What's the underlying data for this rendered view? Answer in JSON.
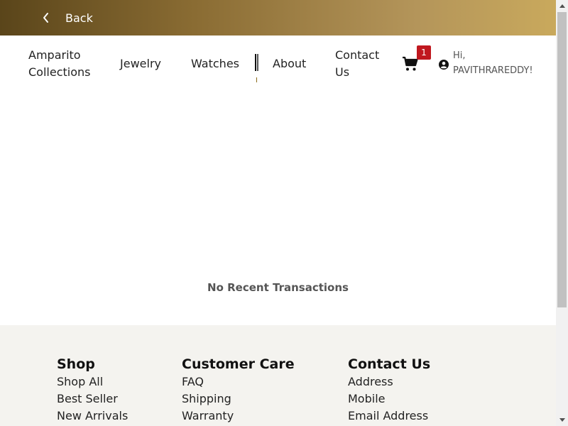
{
  "topbar": {
    "back_label": "Back"
  },
  "nav": {
    "brand": "Amparito Collections",
    "items": [
      {
        "label": "Jewelry"
      },
      {
        "label": "Watches"
      },
      {
        "label": "About"
      },
      {
        "label": "Contact Us"
      }
    ],
    "cart_count": "1",
    "user_greeting": "Hi, PAVITHRAREDDY!"
  },
  "main": {
    "empty_message": "No Recent Transactions"
  },
  "footer": {
    "shop": {
      "title": "Shop",
      "links": [
        "Shop All",
        "Best Seller",
        "New Arrivals"
      ]
    },
    "care": {
      "title": "Customer Care",
      "links": [
        "FAQ",
        "Shipping",
        "Warranty"
      ]
    },
    "contact": {
      "title": "Contact Us",
      "links": [
        "Address",
        "Mobile",
        "Email Address"
      ]
    }
  },
  "colors": {
    "topbar_start": "#5a451a",
    "topbar_end": "#c9a95c",
    "badge": "#c0181f",
    "footer_bg": "#f4f3ef"
  },
  "icons": [
    "chevron-left-icon",
    "cart-icon",
    "user-circle-icon",
    "scroll-up-icon",
    "scroll-down-icon"
  ]
}
